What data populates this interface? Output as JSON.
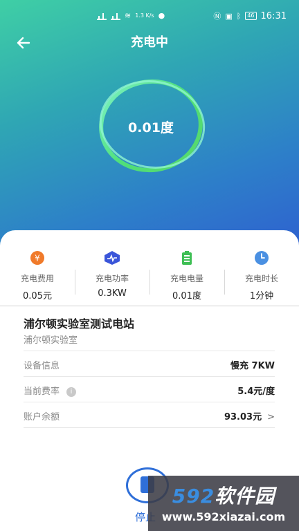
{
  "status_bar": {
    "net_speed": "1.3 K/s",
    "battery": "46",
    "time": "16:31"
  },
  "header": {
    "title": "充电中",
    "back_icon": "arrow-left-icon"
  },
  "gauge": {
    "value": "0.01度"
  },
  "stats": [
    {
      "icon": "yen-coin-icon",
      "label": "充电费用",
      "value": "0.05元",
      "color": "#f07a2a"
    },
    {
      "icon": "power-wave-icon",
      "label": "充电功率",
      "value": "0.3KW",
      "color": "#3a55d9"
    },
    {
      "icon": "battery-icon",
      "label": "充电电量",
      "value": "0.01度",
      "color": "#3fbf55"
    },
    {
      "icon": "clock-icon",
      "label": "充电时长",
      "value": "1分钟",
      "color": "#4a90e2"
    }
  ],
  "station": {
    "name": "浦尔顿实验室测试电站",
    "sub": "浦尔顿实验室"
  },
  "details": {
    "device_label": "设备信息",
    "device_value": "慢充 7KW",
    "rate_label": "当前费率",
    "rate_value": "5.4元/度",
    "balance_label": "账户余额",
    "balance_value": "93.03元"
  },
  "stop": {
    "label": "停止"
  },
  "watermark": {
    "brand_num": "592",
    "brand_text": "软件园",
    "url": "www.592xiazai.com"
  }
}
